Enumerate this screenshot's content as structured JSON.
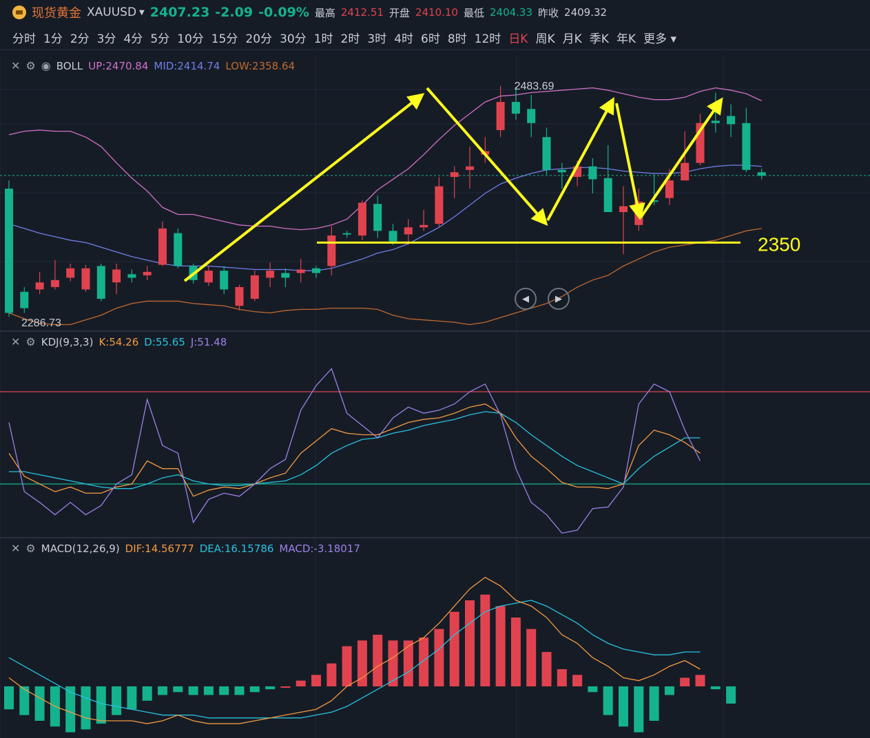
{
  "header": {
    "name": "现货黄金",
    "symbol": "XAUUSD",
    "price": "2407.23",
    "change": "-2.09",
    "change_pct": "-0.09%",
    "high_label": "最高",
    "high": "2412.51",
    "open_label": "开盘",
    "open": "2410.10",
    "low_label": "最低",
    "low": "2404.33",
    "prev_label": "昨收",
    "prev": "2409.32"
  },
  "intervals": [
    "分时",
    "1分",
    "2分",
    "3分",
    "4分",
    "5分",
    "10分",
    "15分",
    "20分",
    "30分",
    "1时",
    "2时",
    "3时",
    "4时",
    "6时",
    "8时",
    "12时",
    "日K",
    "周K",
    "月K",
    "季K",
    "年K",
    "更多"
  ],
  "active_interval": "日K",
  "boll": {
    "name": "BOLL",
    "up_label": "UP:2470.84",
    "mid_label": "MID:2414.74",
    "low_label": "LOW:2358.64"
  },
  "kdj": {
    "name": "KDJ(9,3,3)",
    "k_label": "K:54.26",
    "d_label": "D:55.65",
    "j_label": "J:51.48"
  },
  "macd": {
    "name": "MACD(12,26,9)",
    "dif_label": "DIF:14.56777",
    "dea_label": "DEA:16.15786",
    "macd_label": "MACD:-3.18017"
  },
  "colors": {
    "up": "#e0434f",
    "down": "#14b38e",
    "boll_up": "#d070c8",
    "boll_mid": "#6f7fe6",
    "boll_low": "#c06a30",
    "k": "#f39a40",
    "d": "#28c3e0",
    "j": "#9a82e6",
    "annot": "#ffff1e"
  },
  "chart_data": {
    "type": "candlestick",
    "price_ylim": [
      2275,
      2510
    ],
    "high_marker": "2483.69",
    "low_marker": "2286.73",
    "support_label": "2350",
    "support_level": 2350,
    "candles": [
      [
        2396,
        2290,
        2403,
        2286.73
      ],
      [
        2308,
        2294,
        2312,
        2290
      ],
      [
        2310,
        2316,
        2325,
        2306
      ],
      [
        2312,
        2318,
        2335,
        2310
      ],
      [
        2320,
        2328,
        2332,
        2317
      ],
      [
        2310,
        2328,
        2331,
        2308
      ],
      [
        2330,
        2302,
        2332,
        2300
      ],
      [
        2316,
        2327,
        2332,
        2306
      ],
      [
        2323,
        2320,
        2327,
        2316
      ],
      [
        2322,
        2325,
        2330,
        2318
      ],
      [
        2331,
        2362,
        2368,
        2330
      ],
      [
        2358,
        2330,
        2362,
        2328
      ],
      [
        2330,
        2318,
        2332,
        2315
      ],
      [
        2316,
        2326,
        2330,
        2313
      ],
      [
        2326,
        2310,
        2330,
        2306
      ],
      [
        2296,
        2312,
        2314,
        2292
      ],
      [
        2302,
        2322,
        2326,
        2300
      ],
      [
        2320,
        2326,
        2333,
        2312
      ],
      [
        2324,
        2320,
        2328,
        2312
      ],
      [
        2324,
        2327,
        2336,
        2316
      ],
      [
        2328,
        2324,
        2330,
        2320
      ],
      [
        2330,
        2356,
        2364,
        2322
      ],
      [
        2358,
        2357,
        2360,
        2354
      ],
      [
        2356,
        2384,
        2386,
        2352
      ],
      [
        2383,
        2360,
        2390,
        2354
      ],
      [
        2360,
        2351,
        2366,
        2348
      ],
      [
        2357,
        2363,
        2370,
        2348
      ],
      [
        2363,
        2365,
        2378,
        2360
      ],
      [
        2366,
        2398,
        2406,
        2363
      ],
      [
        2406,
        2410,
        2415,
        2388
      ],
      [
        2412,
        2415,
        2432,
        2396
      ],
      [
        2425,
        2428,
        2440,
        2418
      ],
      [
        2446,
        2470,
        2483.69,
        2440
      ],
      [
        2470,
        2460,
        2483,
        2455
      ],
      [
        2464,
        2452,
        2476,
        2440
      ],
      [
        2440,
        2412,
        2448,
        2408
      ],
      [
        2412,
        2410,
        2418,
        2396
      ],
      [
        2406,
        2415,
        2420,
        2398
      ],
      [
        2415,
        2404,
        2422,
        2392
      ],
      [
        2405,
        2376,
        2433,
        2390
      ],
      [
        2376,
        2381,
        2398,
        2340
      ],
      [
        2365,
        2385,
        2396,
        2360
      ],
      [
        2386,
        2385,
        2408,
        2382
      ],
      [
        2388,
        2403,
        2413,
        2382
      ],
      [
        2403,
        2418,
        2445,
        2407
      ],
      [
        2418,
        2452,
        2460,
        2416
      ],
      [
        2454,
        2452,
        2478,
        2444
      ],
      [
        2458,
        2451,
        2468,
        2440
      ],
      [
        2452,
        2412,
        2465,
        2410
      ],
      [
        2410,
        2407,
        2413,
        2404
      ]
    ],
    "boll_up": [
      2442,
      2445,
      2446,
      2445,
      2445,
      2440,
      2432,
      2418,
      2405,
      2394,
      2380,
      2374,
      2374,
      2371,
      2368,
      2365,
      2364,
      2364,
      2362,
      2361,
      2362,
      2365,
      2370,
      2382,
      2395,
      2404,
      2413,
      2425,
      2438,
      2450,
      2460,
      2470,
      2475,
      2476,
      2478,
      2479,
      2480,
      2481,
      2482,
      2480,
      2477,
      2474,
      2472,
      2472,
      2474,
      2479,
      2482,
      2480,
      2477,
      2471
    ],
    "boll_mid": [
      2366,
      2362,
      2358,
      2355,
      2352,
      2350,
      2346,
      2342,
      2338,
      2335,
      2332,
      2330,
      2330,
      2330,
      2329,
      2328,
      2327,
      2327,
      2327,
      2326,
      2326,
      2328,
      2332,
      2336,
      2341,
      2344,
      2349,
      2356,
      2363,
      2372,
      2382,
      2392,
      2400,
      2405,
      2409,
      2412,
      2413,
      2414,
      2414,
      2413,
      2411,
      2410,
      2409,
      2409,
      2410,
      2413,
      2415,
      2416,
      2416,
      2415
    ],
    "boll_low": [
      2290,
      2285,
      2281,
      2280,
      2280,
      2284,
      2288,
      2294,
      2298,
      2300,
      2300,
      2300,
      2298,
      2297,
      2296,
      2293,
      2291,
      2290,
      2292,
      2293,
      2293,
      2294,
      2294,
      2294,
      2293,
      2288,
      2285,
      2284,
      2283,
      2282,
      2280,
      2282,
      2286,
      2290,
      2294,
      2298,
      2304,
      2312,
      2318,
      2322,
      2330,
      2336,
      2342,
      2346,
      2348,
      2350,
      2352,
      2356,
      2360,
      2362
    ],
    "annotations": [
      "arrow up to peak",
      "arrow down to 2350",
      "arrow up",
      "arrow down",
      "arrow up projection"
    ],
    "kdj_ylim": [
      -10,
      110
    ],
    "kdj_k": [
      40,
      25,
      20,
      15,
      18,
      14,
      14,
      18,
      20,
      35,
      30,
      30,
      12,
      16,
      18,
      17,
      20,
      24,
      27,
      40,
      48,
      56,
      53,
      52,
      52,
      56,
      60,
      62,
      63,
      66,
      70,
      72,
      66,
      50,
      38,
      30,
      21,
      18,
      18,
      17,
      20,
      45,
      55,
      52,
      47,
      40
    ],
    "kdj_d": [
      28,
      28,
      26,
      24,
      22,
      20,
      18,
      17,
      17,
      20,
      24,
      26,
      22,
      20,
      19,
      19,
      20,
      21,
      22,
      26,
      32,
      40,
      45,
      49,
      50,
      53,
      55,
      58,
      60,
      62,
      65,
      67,
      66,
      60,
      52,
      45,
      38,
      32,
      28,
      24,
      20,
      30,
      38,
      44,
      50,
      50
    ],
    "kdj_j": [
      60,
      15,
      8,
      0,
      8,
      0,
      6,
      20,
      26,
      75,
      45,
      40,
      -5,
      10,
      14,
      12,
      20,
      30,
      36,
      68,
      84,
      95,
      66,
      58,
      50,
      63,
      70,
      66,
      68,
      72,
      80,
      85,
      65,
      30,
      8,
      0,
      -12,
      -10,
      4,
      5,
      18,
      72,
      85,
      80,
      55,
      35
    ],
    "macd_ylim": [
      -18,
      42
    ],
    "macd_dif": [
      3,
      -1,
      -4,
      -7,
      -9,
      -11,
      -12,
      -12,
      -12,
      -13,
      -12,
      -10,
      -12,
      -13,
      -13,
      -13,
      -12,
      -11,
      -10,
      -9,
      -8,
      -5,
      0,
      3,
      7,
      10,
      14,
      17,
      22,
      28,
      34,
      38,
      35,
      30,
      28,
      24,
      18,
      15,
      10,
      7,
      3,
      2,
      4,
      7,
      9,
      6
    ],
    "macd_dea": [
      10,
      7,
      4,
      1,
      -2,
      -4,
      -6,
      -7,
      -8,
      -9,
      -10,
      -10,
      -10,
      -11,
      -11,
      -11,
      -11,
      -11,
      -11,
      -11,
      -10,
      -9,
      -7,
      -4,
      -1,
      2,
      5,
      9,
      13,
      18,
      22,
      26,
      28,
      29,
      30,
      28,
      25,
      22,
      18,
      15,
      13,
      12,
      11,
      11,
      12,
      12
    ],
    "macd_hist": [
      -8,
      -10,
      -12,
      -14,
      -16,
      -15,
      -13,
      -10,
      -8,
      -5,
      -3,
      -2,
      -3,
      -3,
      -3,
      -3,
      -2,
      -1,
      0,
      2,
      4,
      8,
      14,
      16,
      18,
      16,
      16,
      17,
      20,
      26,
      30,
      32,
      28,
      24,
      20,
      12,
      6,
      4,
      -2,
      -10,
      -14,
      -16,
      -12,
      -3,
      3,
      4,
      -1,
      -6
    ]
  }
}
